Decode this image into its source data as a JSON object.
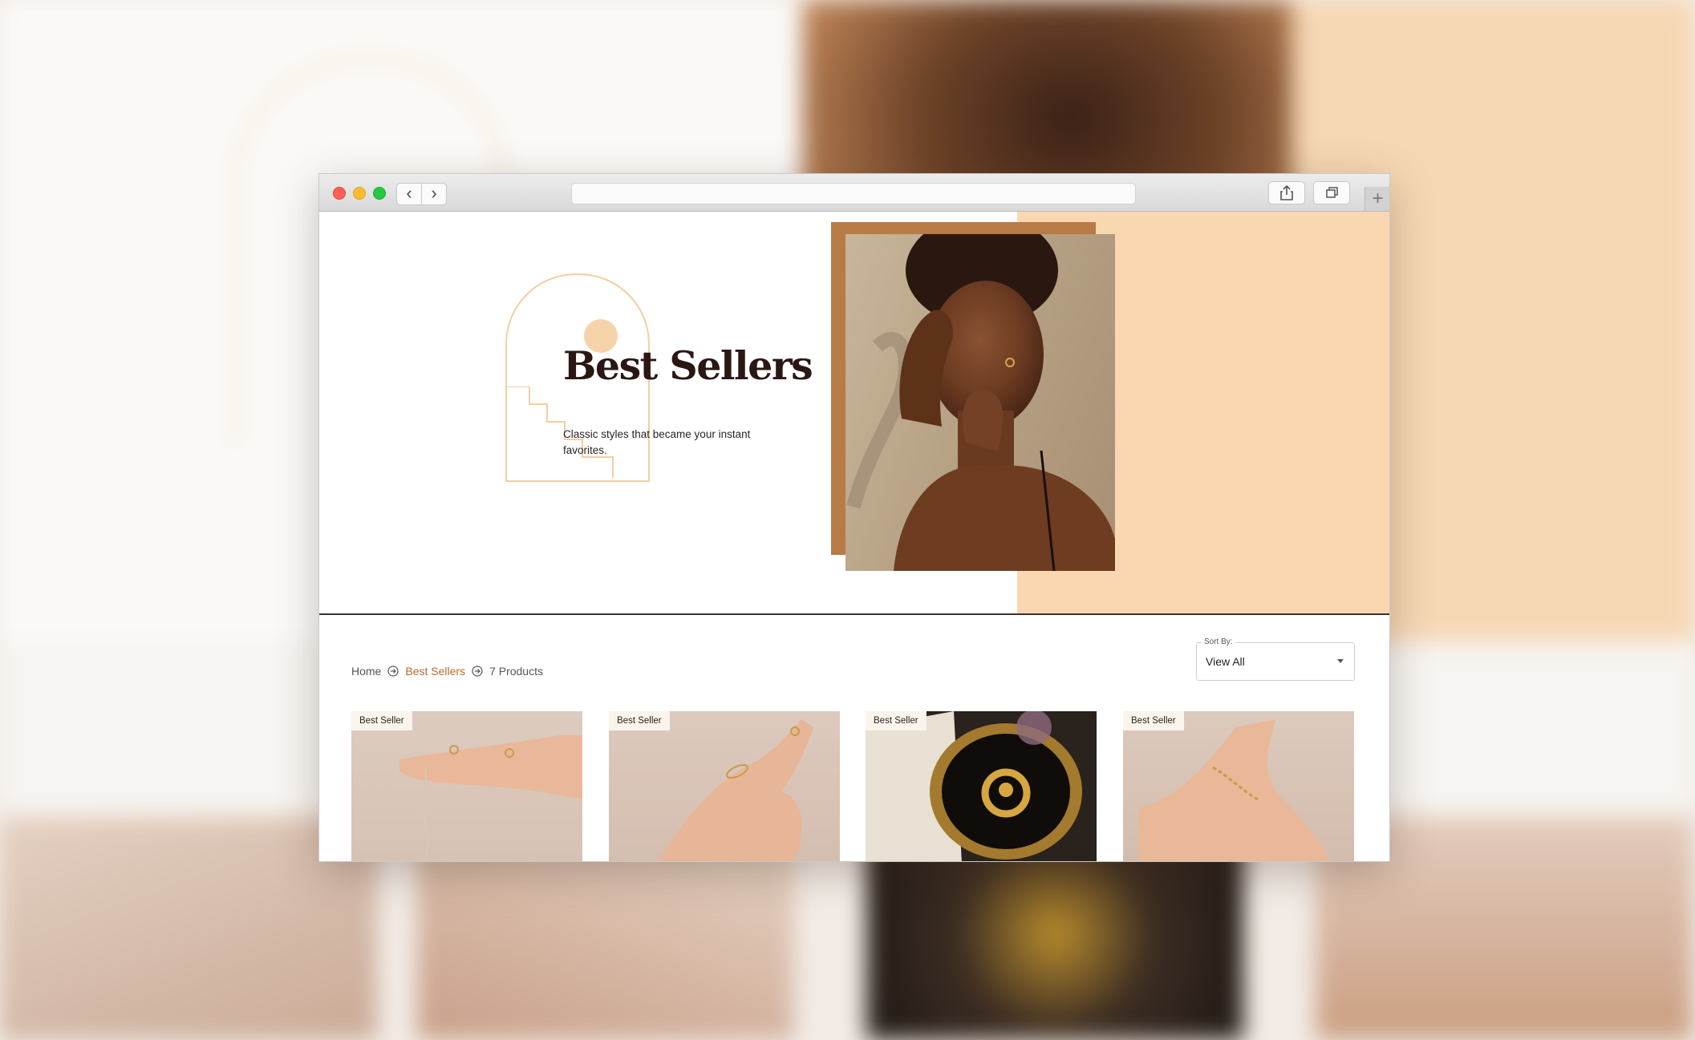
{
  "browser": {
    "back_icon": "chevron-left-icon",
    "forward_icon": "chevron-right-icon",
    "share_icon": "share-icon",
    "tabs_icon": "tabs-icon",
    "new_tab_icon": "plus-icon"
  },
  "hero": {
    "title": "Best Sellers",
    "subtitle": "Classic styles that became your instant favorites.",
    "accent_color": "#f9d7b0",
    "title_color": "#2a1713"
  },
  "breadcrumb": {
    "items": [
      {
        "label": "Home"
      },
      {
        "label": "Best Sellers",
        "active": true
      },
      {
        "label": "7 Products"
      }
    ],
    "active_color": "#b86a2d"
  },
  "sort": {
    "label": "Sort By:",
    "value": "View All"
  },
  "products": [
    {
      "badge": "Best Seller"
    },
    {
      "badge": "Best Seller"
    },
    {
      "badge": "Best Seller"
    },
    {
      "badge": "Best Seller"
    }
  ]
}
